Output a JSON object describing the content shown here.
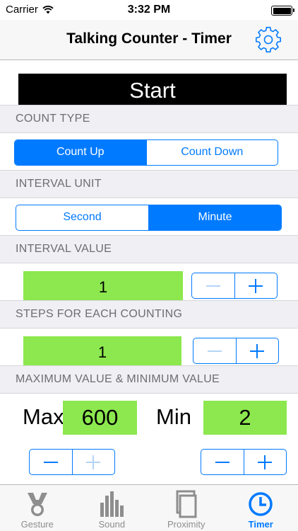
{
  "status": {
    "carrier": "Carrier",
    "time": "3:32 PM"
  },
  "nav": {
    "title": "Talking Counter - Timer",
    "settings_icon": "gear-icon"
  },
  "start_label": "Start",
  "count_type": {
    "header": "COUNT TYPE",
    "options": [
      "Count Up",
      "Count Down"
    ],
    "selected": "Count Up"
  },
  "interval_unit": {
    "header": "INTERVAL UNIT",
    "options": [
      "Second",
      "Minute"
    ],
    "selected": "Minute"
  },
  "interval_value": {
    "header": "INTERVAL VALUE",
    "value": "1"
  },
  "steps": {
    "header": "STEPS FOR EACH COUNTING",
    "value": "1"
  },
  "max_min": {
    "header": "MAXIMUM VALUE &  MINIMUM VALUE",
    "max_label": "Max",
    "max_value": "600",
    "min_label": "Min",
    "min_value": "2"
  },
  "tabs": [
    {
      "label": "Gesture",
      "icon": "gesture-icon"
    },
    {
      "label": "Sound",
      "icon": "sound-icon"
    },
    {
      "label": "Proximity",
      "icon": "proximity-icon"
    },
    {
      "label": "Timer",
      "icon": "timer-icon"
    }
  ],
  "active_tab": "Timer",
  "colors": {
    "accent": "#007aff",
    "value_box": "#8ce84e",
    "start_bg": "#000000"
  }
}
